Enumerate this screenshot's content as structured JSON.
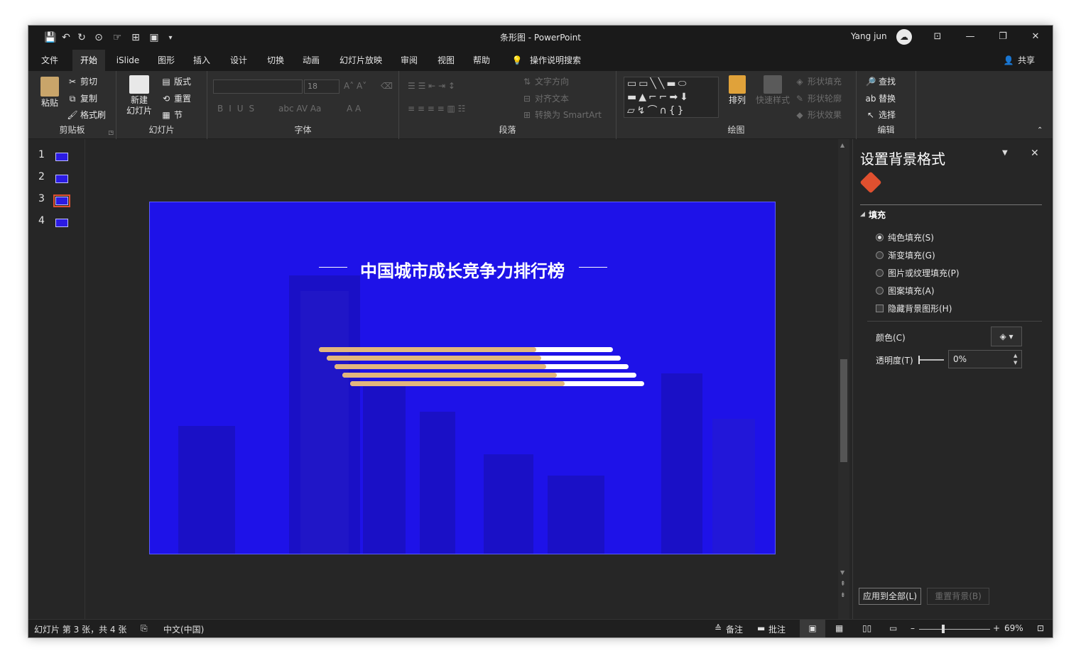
{
  "window": {
    "doc_title": "条形图 - PowerPoint",
    "user": "Yang jun",
    "minimize": "—",
    "restore": "❐",
    "close": "✕"
  },
  "qat": {
    "save": "💾",
    "undo": "↶",
    "redo": "↻",
    "more": "▾"
  },
  "tabs": [
    "文件",
    "开始",
    "iSlide",
    "图形",
    "插入",
    "设计",
    "切换",
    "动画",
    "幻灯片放映",
    "审阅",
    "视图",
    "帮助"
  ],
  "search_label": "操作说明搜索",
  "share_label": "共享",
  "ribbon": {
    "clipboard": {
      "label": "剪贴板",
      "paste": "粘贴",
      "cut": "剪切",
      "copy": "复制",
      "painter": "格式刷"
    },
    "slides": {
      "label": "幻灯片",
      "new_line1": "新建",
      "new_line2": "幻灯片",
      "layout": "版式",
      "reset": "重置",
      "section": "节"
    },
    "font": {
      "label": "字体",
      "size": "18"
    },
    "paragraph": {
      "label": "段落",
      "text_dir": "文字方向",
      "align_text": "对齐文本",
      "smartart": "转换为 SmartArt"
    },
    "drawing": {
      "label": "绘图",
      "arrange": "排列",
      "quick_styles": "快速样式",
      "shape_fill": "形状填充",
      "shape_outline": "形状轮廓",
      "shape_effects": "形状效果"
    },
    "editing": {
      "label": "编辑",
      "find": "查找",
      "replace": "替换",
      "select": "选择"
    }
  },
  "thumbnails": [
    "1",
    "2",
    "3",
    "4"
  ],
  "slide": {
    "title": "中国城市成长竞争力排行榜",
    "bars": [
      0.74,
      0.73,
      0.72,
      0.73,
      0.73
    ]
  },
  "pane": {
    "title": "设置背景格式",
    "section": "填充",
    "options": [
      "纯色填充(S)",
      "渐变填充(G)",
      "图片或纹理填充(P)",
      "图案填充(A)"
    ],
    "checkbox": "隐藏背景图形(H)",
    "color_label": "颜色(C)",
    "transparency_label": "透明度(T)",
    "transparency_value": "0%",
    "apply_all": "应用到全部(L)",
    "reset_bg": "重置背景(B)"
  },
  "status": {
    "slide_info": "幻灯片 第 3 张，共 4 张",
    "language": "中文(中国)",
    "notes": "备注",
    "comments": "批注",
    "zoom": "69%"
  },
  "colors": {
    "slide_bg": "#1e12e8",
    "bar_accent": "#e2b67d",
    "accent": "#e0502f"
  }
}
